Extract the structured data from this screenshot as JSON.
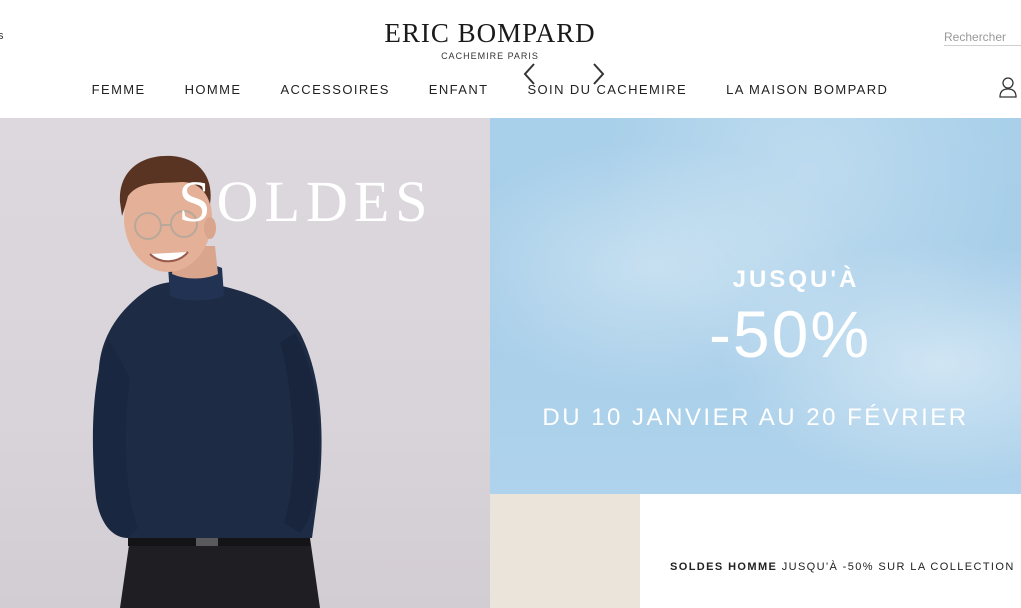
{
  "header": {
    "lang_fragment": "s",
    "brand_name": "ERIC BOMPARD",
    "brand_sub": "CACHEMIRE PARIS",
    "search_placeholder": "Rechercher",
    "nav": [
      {
        "label": "FEMME"
      },
      {
        "label": "HOMME"
      },
      {
        "label": "ACCESSOIRES"
      },
      {
        "label": "ENFANT"
      },
      {
        "label": "SOIN DU CACHEMIRE"
      },
      {
        "label": "LA MAISON BOMPARD"
      }
    ],
    "user_icon": "user-icon"
  },
  "hero": {
    "title": "SOLDES",
    "upto": "JUSQU'À",
    "discount": "-50%",
    "dates": "DU 10 JANVIER AU 20 FÉVRIER",
    "sky_color": "#a9d0ea"
  },
  "carousel": {
    "prev_icon": "chevron-left-icon",
    "next_icon": "chevron-right-icon",
    "caption_bold": "SOLDES HOMME",
    "caption_rest": " JUSQU'À -50% SUR LA COLLECTION"
  }
}
